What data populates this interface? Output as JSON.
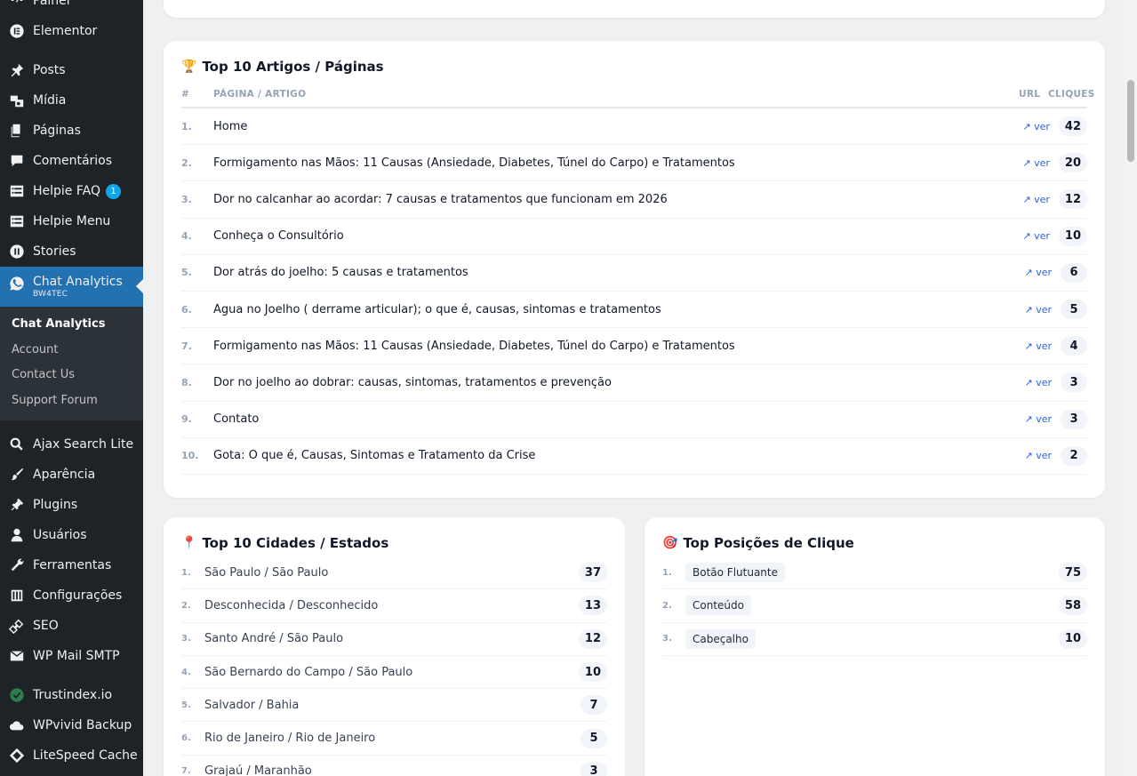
{
  "sidebar": {
    "items_top": [
      {
        "label": "Painel",
        "icon": "dashboard-icon"
      },
      {
        "label": "Elementor",
        "icon": "elementor-icon"
      }
    ],
    "items_mid": [
      {
        "label": "Posts",
        "icon": "pin-icon"
      },
      {
        "label": "Mídia",
        "icon": "media-icon"
      },
      {
        "label": "Páginas",
        "icon": "pages-icon"
      },
      {
        "label": "Comentários",
        "icon": "comments-icon"
      },
      {
        "label": "Helpie FAQ",
        "icon": "list-icon",
        "badge": "1"
      },
      {
        "label": "Helpie Menu",
        "icon": "list-icon"
      },
      {
        "label": "Stories",
        "icon": "stories-icon"
      }
    ],
    "active": {
      "label": "Chat Analytics",
      "sub": "BW4TEC",
      "icon": "whatsapp-icon"
    },
    "submenu": [
      "Chat Analytics",
      "Account",
      "Contact Us",
      "Support Forum"
    ],
    "items_bottom": [
      {
        "label": "Ajax Search Lite",
        "icon": "search-icon"
      },
      {
        "label": "Aparência",
        "icon": "brush-icon"
      },
      {
        "label": "Plugins",
        "icon": "plugin-icon"
      },
      {
        "label": "Usuários",
        "icon": "user-icon"
      },
      {
        "label": "Ferramentas",
        "icon": "wrench-icon"
      },
      {
        "label": "Configurações",
        "icon": "settings-icon"
      },
      {
        "label": "SEO",
        "icon": "seo-icon"
      },
      {
        "label": "WP Mail SMTP",
        "icon": "mail-icon"
      }
    ],
    "items_end": [
      {
        "label": "Trustindex.io",
        "icon": "check-circle-icon"
      },
      {
        "label": "WPvivid Backup",
        "icon": "cloud-icon"
      },
      {
        "label": "LiteSpeed Cache",
        "icon": "diamond-icon"
      }
    ]
  },
  "articles": {
    "title": "Top 10 Artigos / Páginas",
    "icon": "🏆",
    "headers": {
      "num": "#",
      "page": "PÁGINA / ARTIGO",
      "url": "URL",
      "clicks": "CLIQUES"
    },
    "link_label": "↗ ver",
    "rows": [
      {
        "n": "1.",
        "title": "Home",
        "clicks": "42"
      },
      {
        "n": "2.",
        "title": "Formigamento nas Mãos: 11 Causas (Ansiedade, Diabetes, Túnel do Carpo) e Tratamentos",
        "clicks": "20"
      },
      {
        "n": "3.",
        "title": "Dor no calcanhar ao acordar: 7 causas e tratamentos que funcionam em 2026",
        "clicks": "12"
      },
      {
        "n": "4.",
        "title": "Conheça o Consultório",
        "clicks": "10"
      },
      {
        "n": "5.",
        "title": "Dor atrás do joelho: 5 causas e tratamentos",
        "clicks": "6"
      },
      {
        "n": "6.",
        "title": "Água no Joelho ( derrame articular); o que é, causas, sintomas e tratamentos",
        "clicks": "5"
      },
      {
        "n": "7.",
        "title": "Formigamento nas Mãos: 11 Causas (Ansiedade, Diabetes, Túnel do Carpo) e Tratamentos",
        "clicks": "4"
      },
      {
        "n": "8.",
        "title": "Dor no joelho ao dobrar: causas, sintomas, tratamentos e prevenção",
        "clicks": "3"
      },
      {
        "n": "9.",
        "title": "Contato",
        "clicks": "3"
      },
      {
        "n": "10.",
        "title": "Gota: O que é, Causas, Sintomas e Tratamento da Crise",
        "clicks": "2"
      }
    ]
  },
  "cities": {
    "title": "Top 10 Cidades / Estados",
    "icon": "📍",
    "rows": [
      {
        "n": "1.",
        "title": "São Paulo / São Paulo",
        "count": "37"
      },
      {
        "n": "2.",
        "title": "Desconhecida / Desconhecido",
        "count": "13"
      },
      {
        "n": "3.",
        "title": "Santo André / São Paulo",
        "count": "12"
      },
      {
        "n": "4.",
        "title": "São Bernardo do Campo / São Paulo",
        "count": "10"
      },
      {
        "n": "5.",
        "title": "Salvador / Bahia",
        "count": "7"
      },
      {
        "n": "6.",
        "title": "Rio de Janeiro / Rio de Janeiro",
        "count": "5"
      },
      {
        "n": "7.",
        "title": "Grajaú / Maranhão",
        "count": "3"
      }
    ]
  },
  "positions": {
    "title": "Top Posições de Clique",
    "icon": "🎯",
    "rows": [
      {
        "n": "1.",
        "title": "Botão Flutuante",
        "count": "75"
      },
      {
        "n": "2.",
        "title": "Conteúdo",
        "count": "58"
      },
      {
        "n": "3.",
        "title": "Cabeçalho",
        "count": "10"
      }
    ]
  }
}
